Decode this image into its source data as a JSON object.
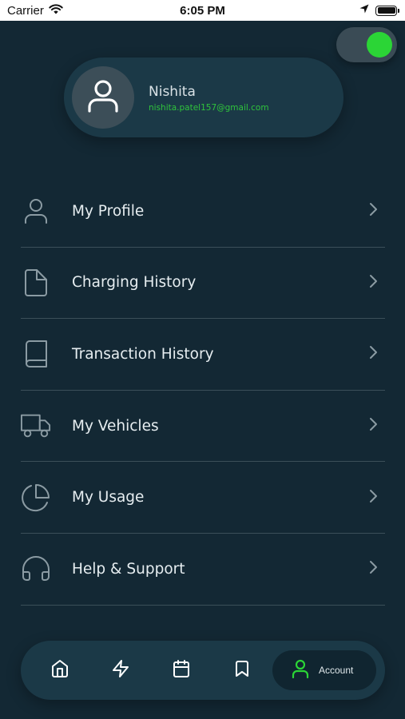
{
  "status_bar": {
    "carrier": "Carrier",
    "time": "6:05 PM"
  },
  "theme_toggle": {
    "on": true,
    "knob_color": "#2bd536"
  },
  "profile": {
    "name": "Nishita",
    "email": "nishita.patel157@gmail.com"
  },
  "menu": {
    "items": [
      {
        "label": "My Profile",
        "icon": "user-icon"
      },
      {
        "label": "Charging History",
        "icon": "file-icon"
      },
      {
        "label": "Transaction History",
        "icon": "book-icon"
      },
      {
        "label": "My Vehicles",
        "icon": "truck-icon"
      },
      {
        "label": "My Usage",
        "icon": "pie-chart-icon"
      },
      {
        "label": "Help & Support",
        "icon": "headphones-icon"
      }
    ]
  },
  "tab_bar": {
    "tabs": [
      {
        "icon": "home-icon"
      },
      {
        "icon": "lightning-icon"
      },
      {
        "icon": "calendar-icon"
      },
      {
        "icon": "bookmark-icon"
      },
      {
        "icon": "user-icon",
        "label": "Account",
        "active": true
      }
    ]
  },
  "colors": {
    "background": "#132834",
    "card": "#1b3947",
    "accent": "#2bd536",
    "email": "#2fc33c",
    "divider": "#3b4f59",
    "icon": "#8b9ba3"
  }
}
